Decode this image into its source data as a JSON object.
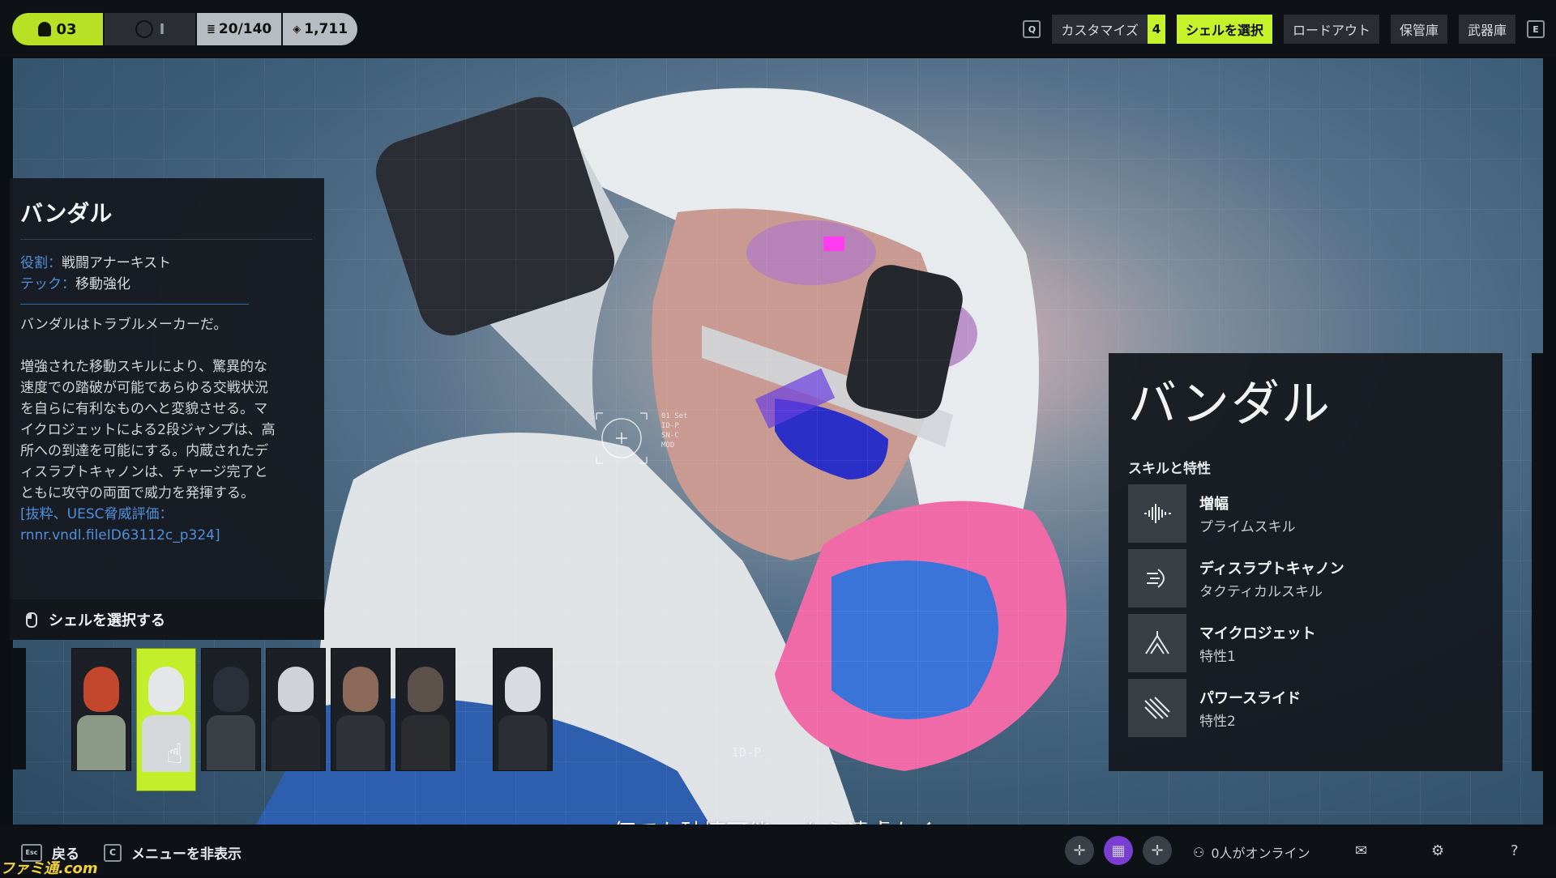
{
  "topbar": {
    "level": "03",
    "progress_label": "I",
    "stats": [
      {
        "icon": "list-icon",
        "value": "20/140"
      },
      {
        "icon": "currency-icon",
        "value": "1,711"
      }
    ],
    "left_key": "Q",
    "right_key": "E",
    "nav": [
      {
        "label": "カスタマイズ",
        "badge": "4",
        "active": false
      },
      {
        "label": "シェルを選択",
        "active": true
      },
      {
        "label": "ロードアウト",
        "active": false
      },
      {
        "label": "保管庫",
        "active": false
      },
      {
        "label": "武器庫",
        "active": false
      }
    ]
  },
  "info": {
    "title": "バンダル",
    "role_key": "役割：",
    "role_value": "戦闘アナーキスト",
    "tech_key": "テック：",
    "tech_value": "移動強化",
    "tagline": "バンダルはトラブルメーカーだ。",
    "description": "増強された移動スキルにより、驚異的な速度での踏破が可能であらゆる交戦状況を自らに有利なものへと変貌させる。マイクロジェットによる2段ジャンプは、高所への到達を可能にする。内蔵されたディスラプトキャノンは、チャージ完了とともに攻守の両面で威力を発揮する。",
    "quote": "[抜粋、UESC脅威評価：rnnr.vndl.fileID63112c_p324]",
    "select_label": "シェルを選択する"
  },
  "scene": {
    "hud_text": "01 Set\nID-P\nSN-C\nMOD",
    "id_label": "ID-P",
    "subtitle": "何でも破壊可能… なら遠慮なく。"
  },
  "roster": [
    {
      "name": "shell-card-1",
      "head": "#c2472c",
      "body": "#8a9a86"
    },
    {
      "name": "shell-card-vandal",
      "head": "#e4e6e8",
      "body": "#d5d8db",
      "selected": true
    },
    {
      "name": "shell-card-3",
      "head": "#2a2f3a",
      "body": "#3b3f46"
    },
    {
      "name": "shell-card-4",
      "head": "#cfd3d8",
      "body": "#23262b"
    },
    {
      "name": "shell-card-5",
      "head": "#8c6a5a",
      "body": "#2f3238"
    },
    {
      "name": "shell-card-6",
      "head": "#5c524b",
      "body": "#2a2c30"
    },
    {
      "name": "shell-card-7",
      "head": "#d8dbe0",
      "body": "#2b2e34"
    }
  ],
  "skills": {
    "name": "バンダル",
    "section": "スキルと特性",
    "items": [
      {
        "icon": "amplify-wave-icon",
        "title": "増幅",
        "type": "プライムスキル"
      },
      {
        "icon": "disrupt-cannon-icon",
        "title": "ディスラプトキャノン",
        "type": "タクティカルスキル"
      },
      {
        "icon": "microjet-icon",
        "title": "マイクロジェット",
        "type": "特性1"
      },
      {
        "icon": "power-slide-icon",
        "title": "パワースライド",
        "type": "特性2"
      }
    ]
  },
  "bottombar": {
    "back_key": "Esc",
    "back_label": "戻る",
    "hide_key": "C",
    "hide_label": "メニューを非表示",
    "online": "0人がオンライン"
  },
  "watermark": "ファミ通.com",
  "colors": {
    "accent": "#c6f22c",
    "link": "#4f8fd8",
    "panel": "#161a20"
  }
}
